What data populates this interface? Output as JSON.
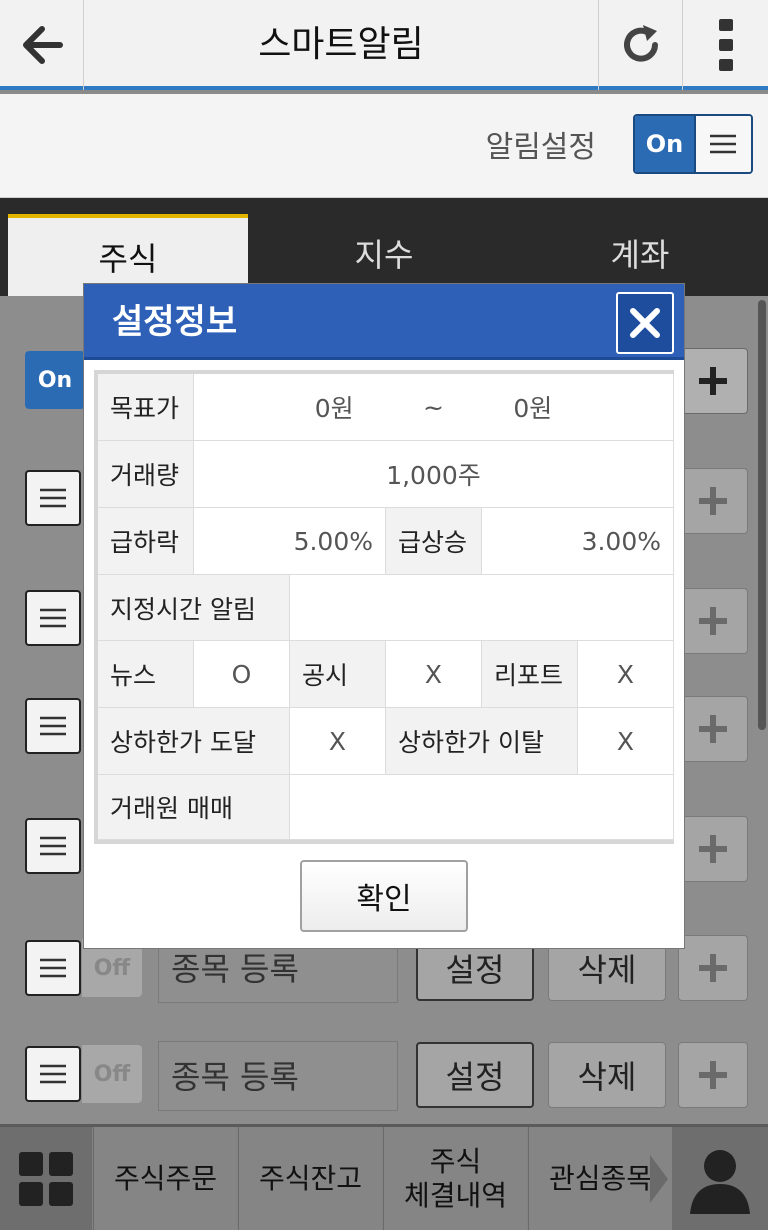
{
  "header": {
    "title": "스마트알림"
  },
  "alarm": {
    "label": "알림설정",
    "toggle": "On"
  },
  "tabs": [
    {
      "label": "주식"
    },
    {
      "label": "지수"
    },
    {
      "label": "계좌"
    }
  ],
  "rows": {
    "on_label": "On",
    "off_label": "Off",
    "name_placeholder": "종목 등록",
    "set_label": "설정",
    "delete_label": "삭제"
  },
  "bottom_nav": {
    "items": [
      {
        "label": "주식주문"
      },
      {
        "label": "주식잔고"
      },
      {
        "line1": "주식",
        "line2": "체결내역"
      },
      {
        "label": "관심종목"
      }
    ]
  },
  "modal": {
    "title": "설정정보",
    "target_price": {
      "label": "목표가",
      "from": "0원",
      "sep": "~",
      "to": "0원"
    },
    "volume": {
      "label": "거래량",
      "value": "1,000주"
    },
    "drop": {
      "label": "급하락",
      "value": "5.00%"
    },
    "rise": {
      "label": "급상승",
      "value": "3.00%"
    },
    "time_alarm": {
      "label": "지정시간 알림",
      "value": ""
    },
    "news": {
      "label": "뉴스",
      "value": "O"
    },
    "disclosure": {
      "label": "공시",
      "value": "X"
    },
    "report": {
      "label": "리포트",
      "value": "X"
    },
    "limit_reach": {
      "label": "상하한가 도달",
      "value": "X"
    },
    "limit_break": {
      "label": "상하한가 이탈",
      "value": "X"
    },
    "broker_trade": {
      "label": "거래원 매매",
      "value": ""
    },
    "confirm": "확인"
  }
}
